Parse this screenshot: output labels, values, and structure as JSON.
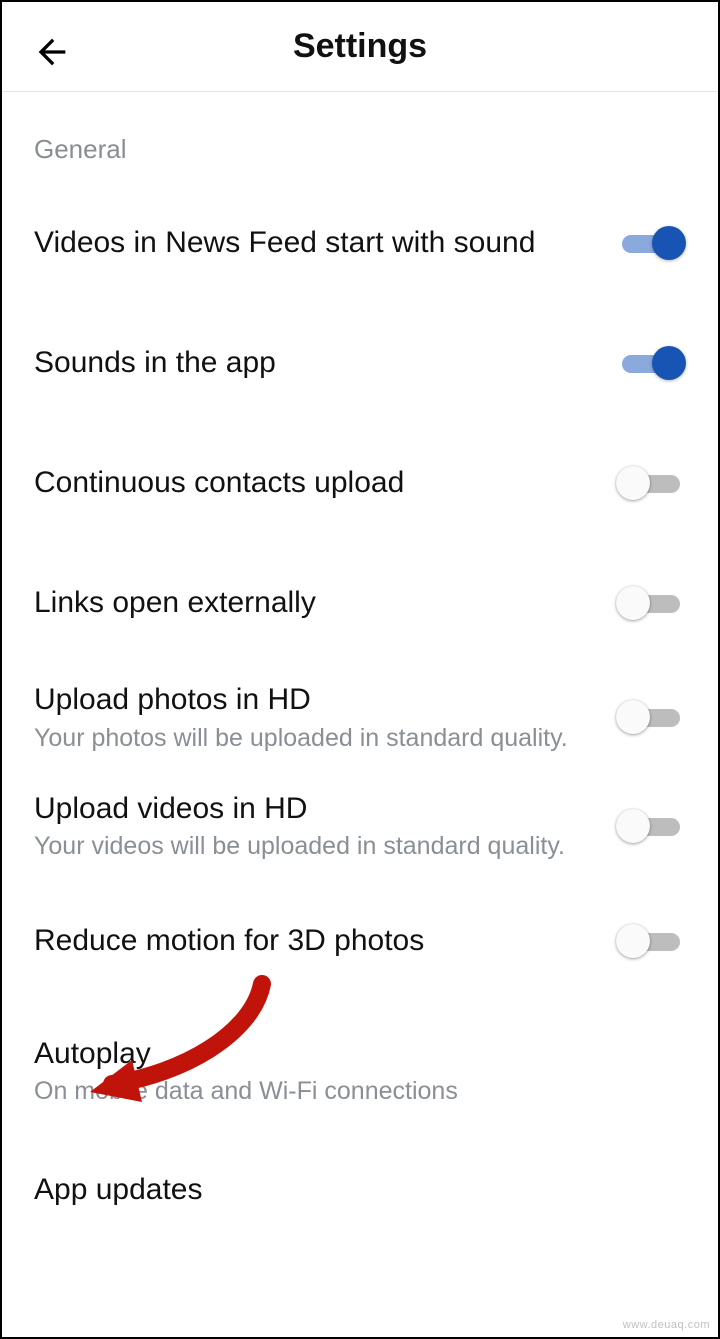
{
  "header": {
    "title": "Settings"
  },
  "section": {
    "general": "General"
  },
  "rows": [
    {
      "label": "Videos in News Feed start with sound",
      "sub": "",
      "on": true
    },
    {
      "label": "Sounds in the app",
      "sub": "",
      "on": true
    },
    {
      "label": "Continuous contacts upload",
      "sub": "",
      "on": false
    },
    {
      "label": "Links open externally",
      "sub": "",
      "on": false
    },
    {
      "label": "Upload photos in HD",
      "sub": "Your photos will be uploaded in standard quality.",
      "on": false
    },
    {
      "label": "Upload videos in HD",
      "sub": "Your videos will be uploaded in standard quality.",
      "on": false
    },
    {
      "label": "Reduce motion for 3D photos",
      "sub": "",
      "on": false
    },
    {
      "label": "Autoplay",
      "sub": "On mobile data and Wi-Fi connections",
      "on": null
    },
    {
      "label": "App updates",
      "sub": "",
      "on": null
    }
  ],
  "watermark": "www.deuaq.com"
}
